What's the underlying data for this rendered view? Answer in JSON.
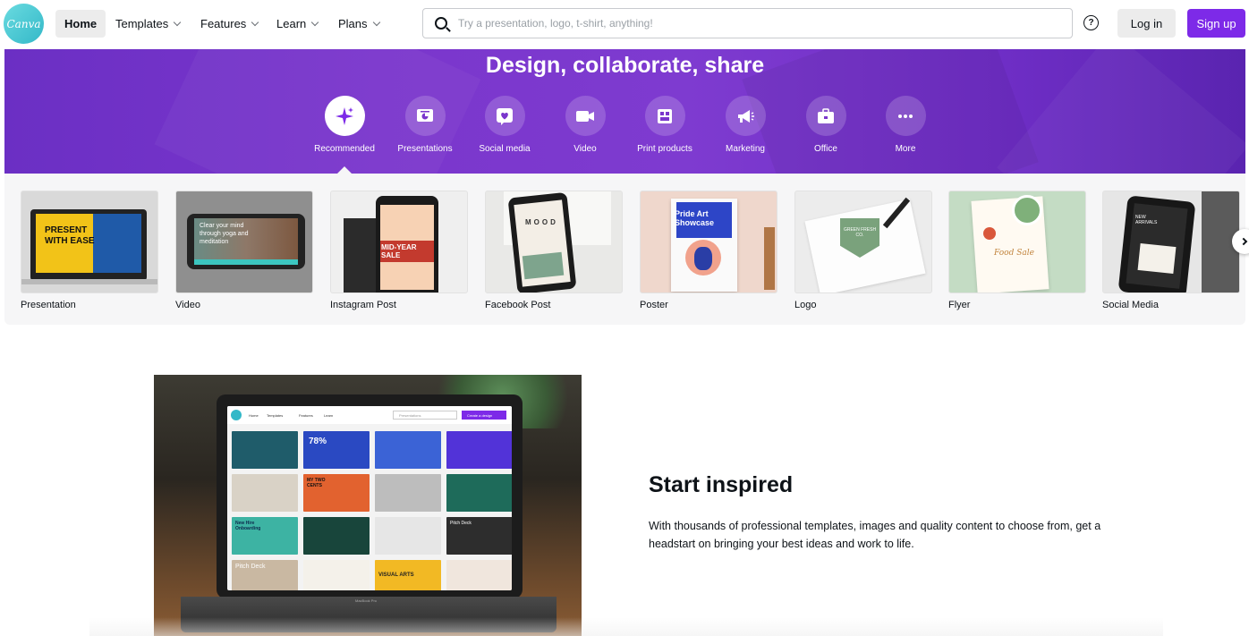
{
  "nav": {
    "logo_text": "Canva",
    "items": [
      {
        "label": "Home",
        "active": true,
        "dropdown": false
      },
      {
        "label": "Templates",
        "active": false,
        "dropdown": true
      },
      {
        "label": "Features",
        "active": false,
        "dropdown": true
      },
      {
        "label": "Learn",
        "active": false,
        "dropdown": true
      },
      {
        "label": "Plans",
        "active": false,
        "dropdown": true
      }
    ],
    "search_placeholder": "Try a presentation, logo, t-shirt, anything!",
    "help_glyph": "?",
    "login_label": "Log in",
    "signup_label": "Sign up"
  },
  "hero": {
    "title": "Design, collaborate, share",
    "categories": [
      {
        "label": "Recommended",
        "icon": "sparkle-icon",
        "active": true
      },
      {
        "label": "Presentations",
        "icon": "presentation-icon",
        "active": false
      },
      {
        "label": "Social media",
        "icon": "heart-icon",
        "active": false
      },
      {
        "label": "Video",
        "icon": "video-camera-icon",
        "active": false
      },
      {
        "label": "Print products",
        "icon": "print-icon",
        "active": false
      },
      {
        "label": "Marketing",
        "icon": "megaphone-icon",
        "active": false
      },
      {
        "label": "Office",
        "icon": "briefcase-icon",
        "active": false
      },
      {
        "label": "More",
        "icon": "more-dots-icon",
        "active": false
      }
    ]
  },
  "templates": [
    {
      "label": "Presentation",
      "thumb_text": "PRESENT WITH EASE"
    },
    {
      "label": "Video",
      "thumb_text": "Clear your mind through yoga and meditation"
    },
    {
      "label": "Instagram Post",
      "thumb_text": "MID-YEAR SALE"
    },
    {
      "label": "Facebook Post",
      "thumb_text": "MOOD"
    },
    {
      "label": "Poster",
      "thumb_text": "Pride Art Showcase"
    },
    {
      "label": "Logo",
      "thumb_text": "GREEN FRESH CO."
    },
    {
      "label": "Flyer",
      "thumb_text": "Food Sale"
    },
    {
      "label": "Social Media",
      "thumb_text": "NEW ARRIVALS"
    }
  ],
  "starter": {
    "title": "Start inspired",
    "text": "With thousands of professional templates, images and quality content to choose from, get a headstart on bringing your best ideas and work to life.",
    "laptop_screen": {
      "nav": [
        "Home",
        "Templates",
        "Features",
        "Learn"
      ],
      "search_placeholder": "Presentations",
      "create_label": "Create a design",
      "tiles": [
        "78%",
        "New Hire Onboarding",
        "MY TWO CENTS",
        "Pitch Deck",
        "VISUAL ARTS",
        "Pitch Deck"
      ],
      "keyboard_brand": "MacBook Pro"
    }
  },
  "colors": {
    "brand_purple": "#7d2ae8",
    "hero_purple": "#7a36cc",
    "canva_teal": "#33b8c8"
  }
}
